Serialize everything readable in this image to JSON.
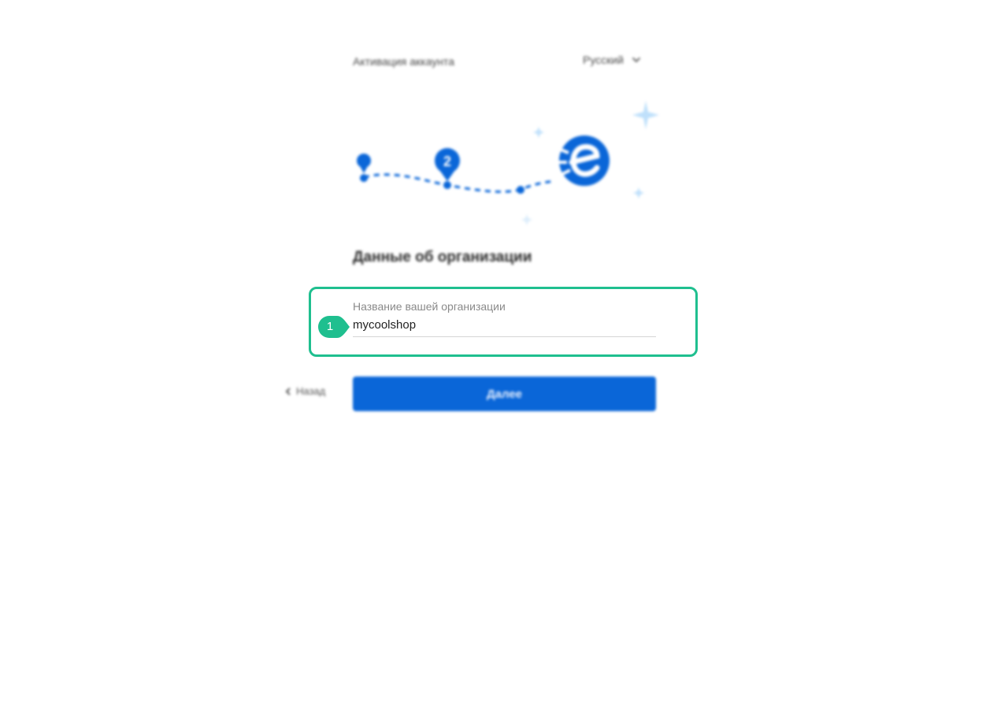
{
  "header": {
    "title": "Активация аккаунта"
  },
  "language": {
    "selected": "Русский"
  },
  "progress": {
    "current_step": "2"
  },
  "section": {
    "title": "Данные об организации"
  },
  "form": {
    "org_name": {
      "label": "Название вашей организации",
      "value": "mycoolshop"
    }
  },
  "annotation": {
    "marker": "1"
  },
  "actions": {
    "back_label": "Назад",
    "next_label": "Далее"
  },
  "colors": {
    "brand": "#0a66d8",
    "highlight": "#1fbf8f",
    "sparkle": "#bfe0fb"
  }
}
